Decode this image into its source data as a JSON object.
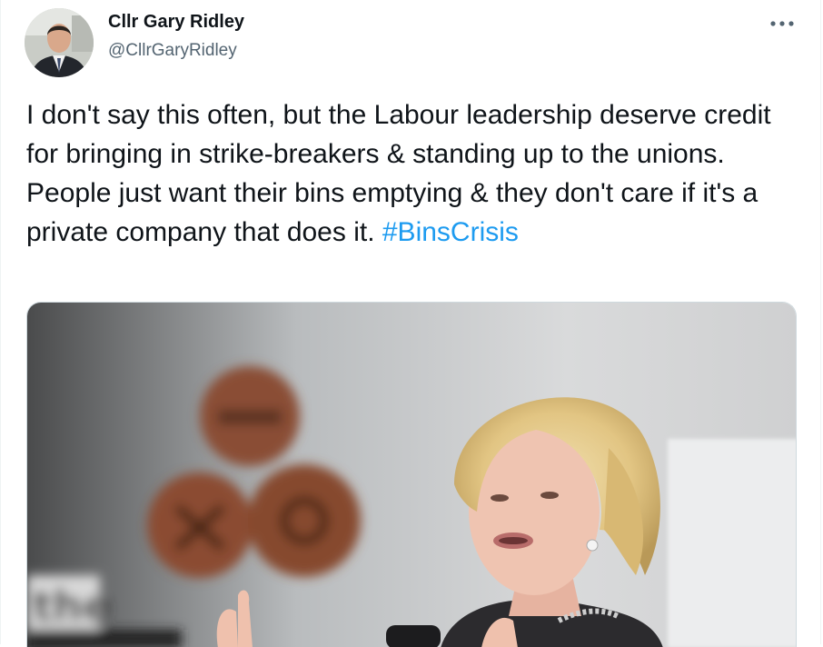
{
  "author": {
    "name": "Cllr Gary Ridley",
    "handle": "@CllrGaryRidley"
  },
  "tweet": {
    "text": "I don't say this often, but the Labour leadership deserve credit for bringing in strike-breakers & standing up to the unions. People just want their bins emptying & they don't care if it's a private company that does it. ",
    "hashtag": "#BinsCrisis"
  },
  "icons": {
    "more": "more-options-icon"
  },
  "colors": {
    "hashtag": "#1d9bf0",
    "handle": "#536471",
    "text": "#0f1419"
  }
}
